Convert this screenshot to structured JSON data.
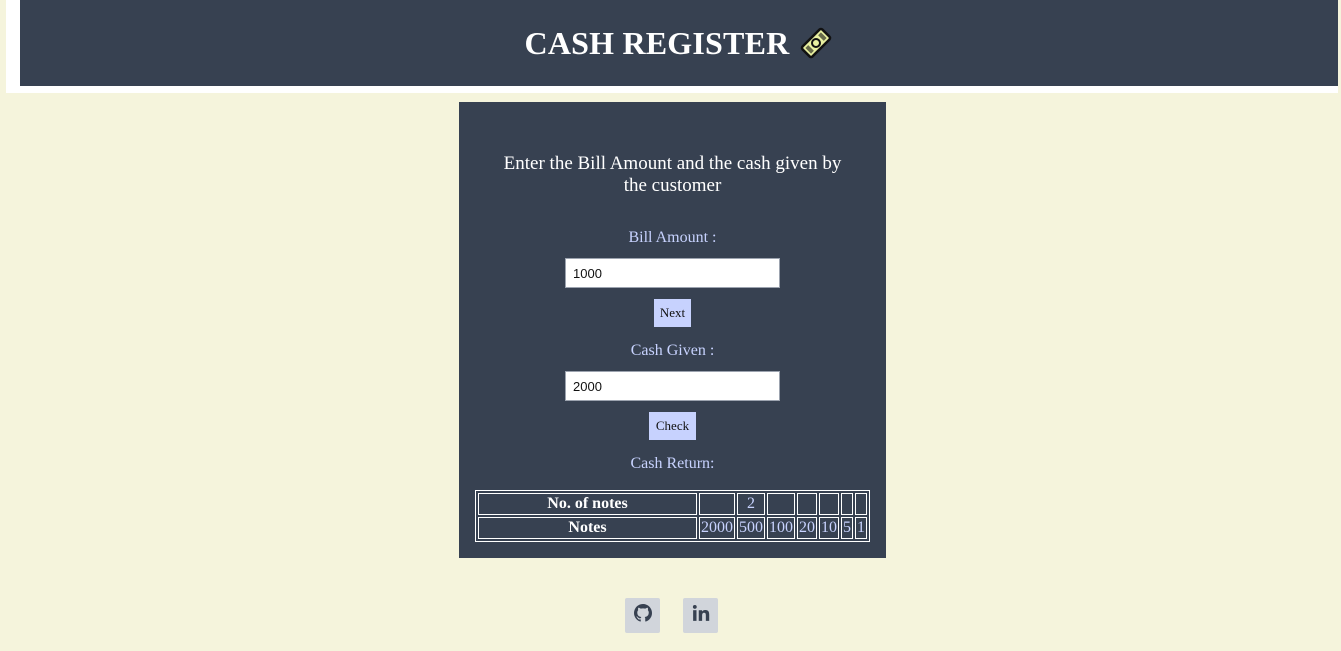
{
  "header": {
    "title": "CASH REGISTER",
    "logo_icon": "cash-register-logo-icon"
  },
  "panel": {
    "instructions": "Enter the Bill Amount and the cash given by the customer",
    "bill_label": "Bill Amount :",
    "bill_value": "1000",
    "next_label": "Next",
    "cash_label": "Cash Given :",
    "cash_value": "2000",
    "check_label": "Check",
    "return_label": "Cash Return:"
  },
  "table": {
    "count_header": "No. of notes",
    "notes_header": "Notes",
    "counts": [
      "",
      "2",
      "",
      "",
      "",
      "",
      ""
    ],
    "notes": [
      "2000",
      "500",
      "100",
      "20",
      "10",
      "5",
      "1"
    ]
  },
  "footer": {
    "links": [
      {
        "icon": "github-icon"
      },
      {
        "icon": "linkedin-icon"
      }
    ]
  },
  "colors": {
    "page_bg": "#f5f4dc",
    "panel_bg": "#374151",
    "accent": "#c7d2fe",
    "icon_bg": "#d1d5db"
  }
}
